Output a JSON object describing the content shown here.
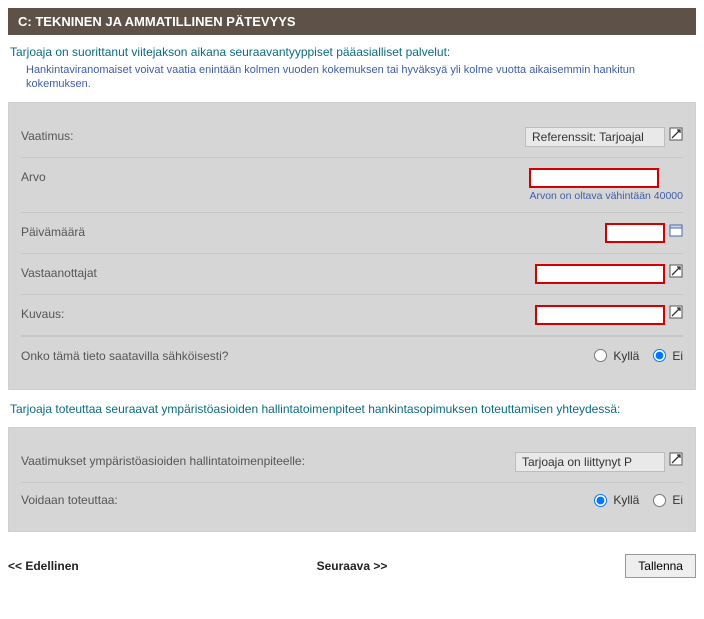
{
  "header": {
    "title": "C: TEKNINEN JA AMMATILLINEN PÄTEVYYS"
  },
  "intro": {
    "main": "Tarjoaja on suorittanut viitejakson aikana seuraavantyyppiset pääasialliset palvelut:",
    "sub": "Hankintaviranomaiset voivat vaatia enintään kolmen vuoden kokemuksen tai hyväksyä yli kolme vuotta aikaisemmin hankitun kokemuksen."
  },
  "panel1": {
    "rows": {
      "vaatimus": {
        "label": "Vaatimus:",
        "value": "Referenssit: Tarjoajal"
      },
      "arvo": {
        "label": "Arvo",
        "hint": "Arvon on oltava vähintään 40000",
        "value": ""
      },
      "paivamaara": {
        "label": "Päivämäärä",
        "value": ""
      },
      "vastaanottajat": {
        "label": "Vastaanottajat",
        "value": ""
      },
      "kuvaus": {
        "label": "Kuvaus:",
        "value": ""
      }
    },
    "eavail": {
      "label": "Onko tämä tieto saatavilla sähköisesti?",
      "yes": "Kyllä",
      "no": "Ei",
      "selected": "no"
    }
  },
  "section2": {
    "title": "Tarjoaja toteuttaa seuraavat ympäristöasioiden hallintatoimenpiteet hankintasopimuksen toteuttamisen yhteydessä:",
    "vaatimukset": {
      "label": "Vaatimukset ympäristöasioiden hallintatoimenpiteelle:",
      "value": "Tarjoaja on liittynyt P"
    },
    "voidaan": {
      "label": "Voidaan toteuttaa:",
      "yes": "Kyllä",
      "no": "Ei",
      "selected": "yes"
    }
  },
  "footer": {
    "prev": "<< Edellinen",
    "next": "Seuraava >>",
    "save": "Tallenna"
  }
}
